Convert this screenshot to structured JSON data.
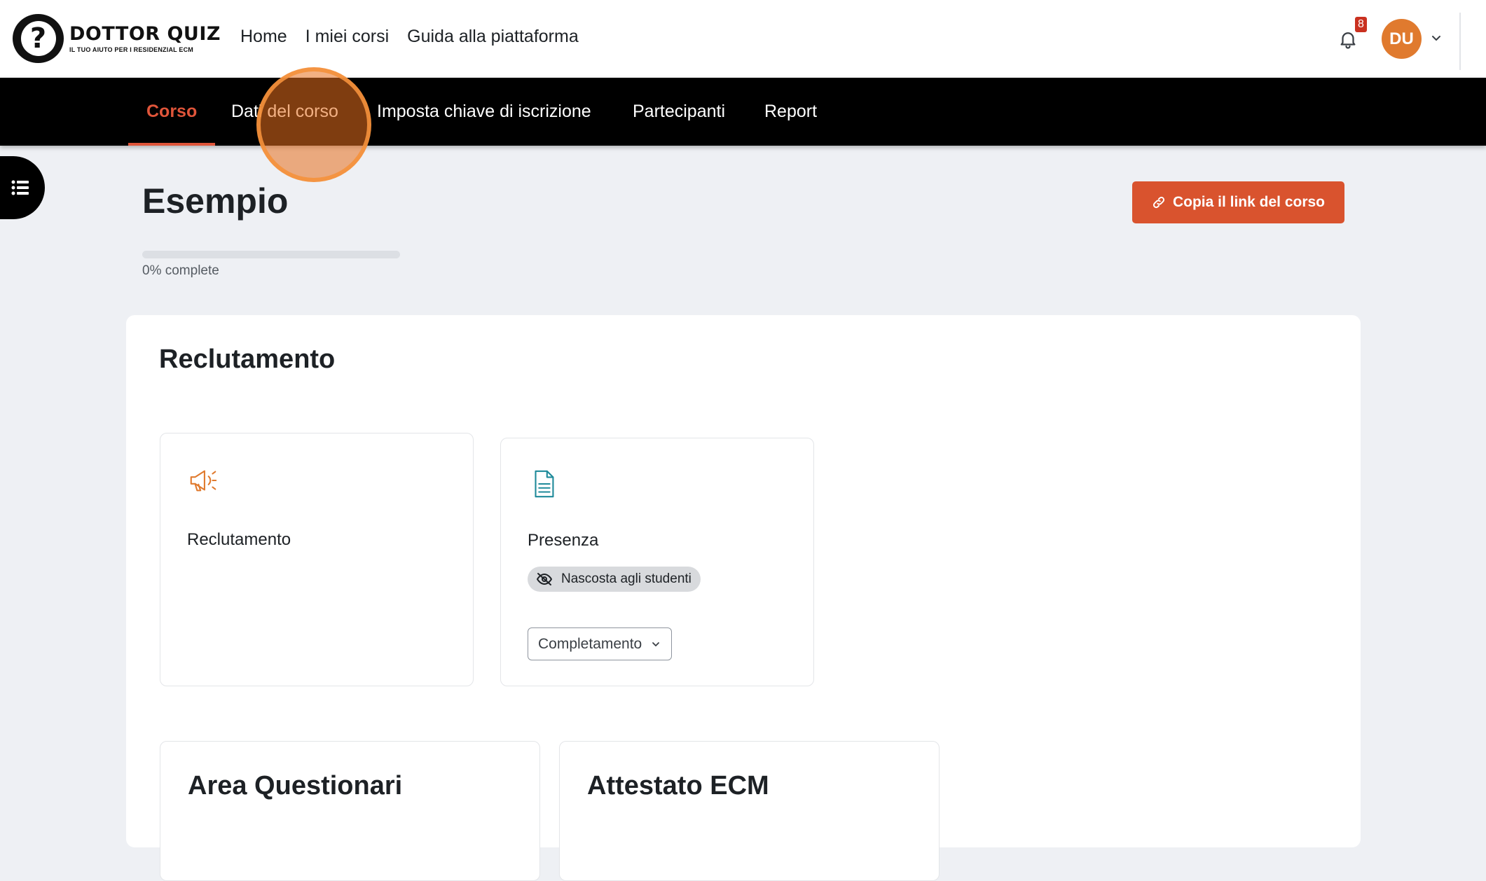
{
  "brand": {
    "title": "DOTTOR QUIZ",
    "subtitle": "IL TUO AIUTO PER I RESIDENZIAL ECM"
  },
  "primary_nav": [
    "Home",
    "I miei corsi",
    "Guida alla piattaforma"
  ],
  "notifications": {
    "count": "8"
  },
  "user": {
    "initials": "DU",
    "avatar_color": "#e07a2e"
  },
  "secondary_nav": {
    "tabs": [
      "Corso",
      "Dati del corso",
      "Imposta chiave di iscrizione",
      "Partecipanti",
      "Report"
    ],
    "active": "Corso"
  },
  "page": {
    "title": "Esempio",
    "copy_link_label": "Copia il link del corso",
    "progress_percent": 0,
    "progress_label": "0% complete"
  },
  "section": {
    "title": "Reclutamento",
    "activities": [
      {
        "name": "Reclutamento",
        "icon": "megaphone-icon"
      },
      {
        "name": "Presenza",
        "icon": "document-icon",
        "badge": "Nascosta agli studenti",
        "completion_label": "Completamento"
      }
    ],
    "subsections": [
      "Area Questionari",
      "Attestato ECM"
    ]
  },
  "colors": {
    "accent": "#e0553a",
    "button": "#d9532e",
    "megaphone": "#e07a2e",
    "document": "#1f8a9a"
  }
}
